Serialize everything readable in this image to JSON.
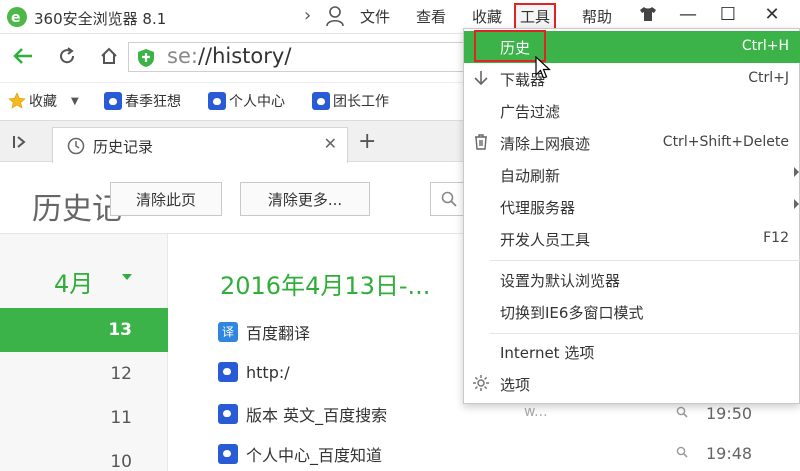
{
  "titlebar": {
    "app_title": "360安全浏览器 8.1",
    "menus": [
      "文件",
      "查看",
      "收藏",
      "工具",
      "帮助"
    ],
    "skin_icon": "shirt-icon",
    "min": "—",
    "max": "☐",
    "close": "✕"
  },
  "address": {
    "url_scheme": "se:",
    "url_path": "//history/"
  },
  "bookmarks": {
    "favorites_label": "收藏",
    "items": [
      "春季狂想",
      "个人中心",
      "团长工作"
    ]
  },
  "tabs": [
    {
      "label": "历史记录"
    }
  ],
  "page": {
    "title": "历史记",
    "clear_page": "清除此页",
    "clear_more": "清除更多..."
  },
  "calendar": {
    "month": "4月",
    "days": [
      "13",
      "12",
      "11",
      "10"
    ],
    "active_day": "13"
  },
  "history": {
    "date_heading": "2016年4月13日-...",
    "items": [
      {
        "title": "百度翻译",
        "icon": "fanyi",
        "meta": "",
        "time": ""
      },
      {
        "title": "http:/",
        "icon": "baidu",
        "meta": "",
        "time": ""
      },
      {
        "title": "版本 英文_百度搜索",
        "icon": "baidu",
        "meta": "w...",
        "time": "19:50"
      },
      {
        "title": "个人中心_百度知道",
        "icon": "baidu",
        "meta": "",
        "time": "19:48"
      }
    ]
  },
  "tools_menu": {
    "items": [
      {
        "label": "历史",
        "shortcut": "Ctrl+H"
      },
      {
        "label": "下载器",
        "shortcut": "Ctrl+J"
      },
      {
        "label": "广告过滤",
        "shortcut": ""
      },
      {
        "label": "清除上网痕迹",
        "shortcut": "Ctrl+Shift+Delete"
      },
      {
        "label": "自动刷新",
        "shortcut": ""
      },
      {
        "label": "代理服务器",
        "shortcut": ""
      },
      {
        "label": "开发人员工具",
        "shortcut": "F12"
      },
      {
        "label": "设置为默认浏览器",
        "shortcut": ""
      },
      {
        "label": "切换到IE6多窗口模式",
        "shortcut": ""
      },
      {
        "label": "Internet 选项",
        "shortcut": ""
      },
      {
        "label": "选项",
        "shortcut": ""
      }
    ]
  },
  "colors": {
    "accent_green": "#3cb349",
    "highlight_red": "#e02424",
    "brand_blue": "#2a5bd7"
  }
}
